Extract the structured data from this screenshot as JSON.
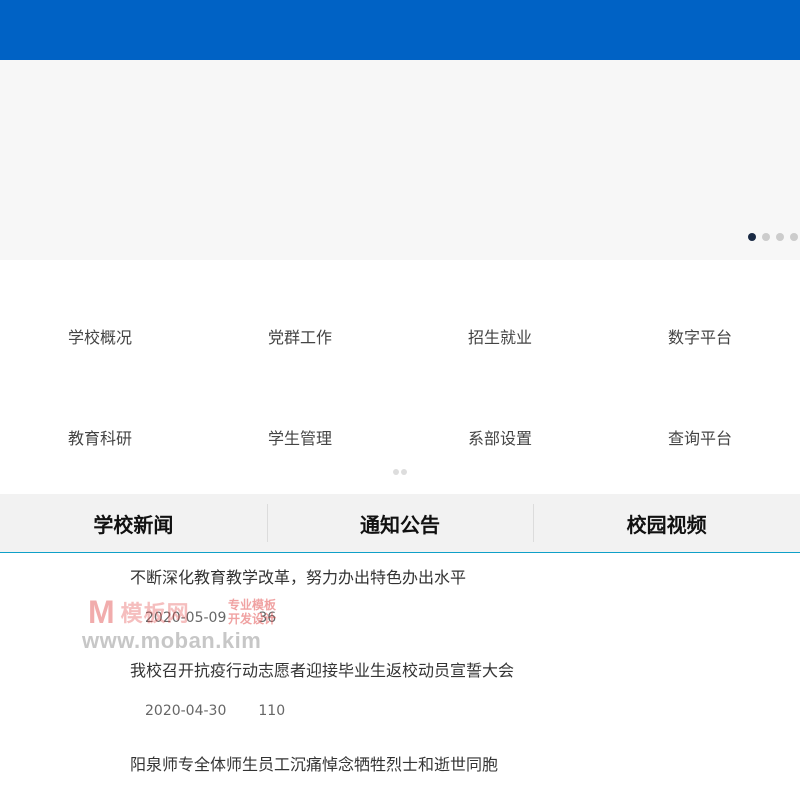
{
  "banner": {
    "dots": 4,
    "active_dot": 1
  },
  "nav": {
    "items": [
      {
        "label": "学校概况"
      },
      {
        "label": "党群工作"
      },
      {
        "label": "招生就业"
      },
      {
        "label": "数字平台"
      },
      {
        "label": "教育科研"
      },
      {
        "label": "学生管理"
      },
      {
        "label": "系部设置"
      },
      {
        "label": "查询平台"
      }
    ],
    "pager_dots": 2
  },
  "tabs": [
    {
      "label": "学校新闻"
    },
    {
      "label": "通知公告"
    },
    {
      "label": "校园视频"
    }
  ],
  "news": [
    {
      "title": "不断深化教育教学改革，努力办出特色办出水平",
      "date": "2020-05-09",
      "views": "36"
    },
    {
      "title": "我校召开抗疫行动志愿者迎接毕业生返校动员宣誓大会",
      "date": "2020-04-30",
      "views": "110"
    },
    {
      "title": "阳泉师专全体师生员工沉痛悼念牺牲烈士和逝世同胞",
      "date": "",
      "views": ""
    }
  ],
  "watermark": {
    "logo_letter": "M",
    "brand": "模板网",
    "tagline_1": "专业模板",
    "tagline_2": "开发设计",
    "url": "www.moban.kim"
  },
  "colors": {
    "header": "#0062c5",
    "tab_underline": "#0fa0c8",
    "active_dot": "#1a2a44"
  }
}
